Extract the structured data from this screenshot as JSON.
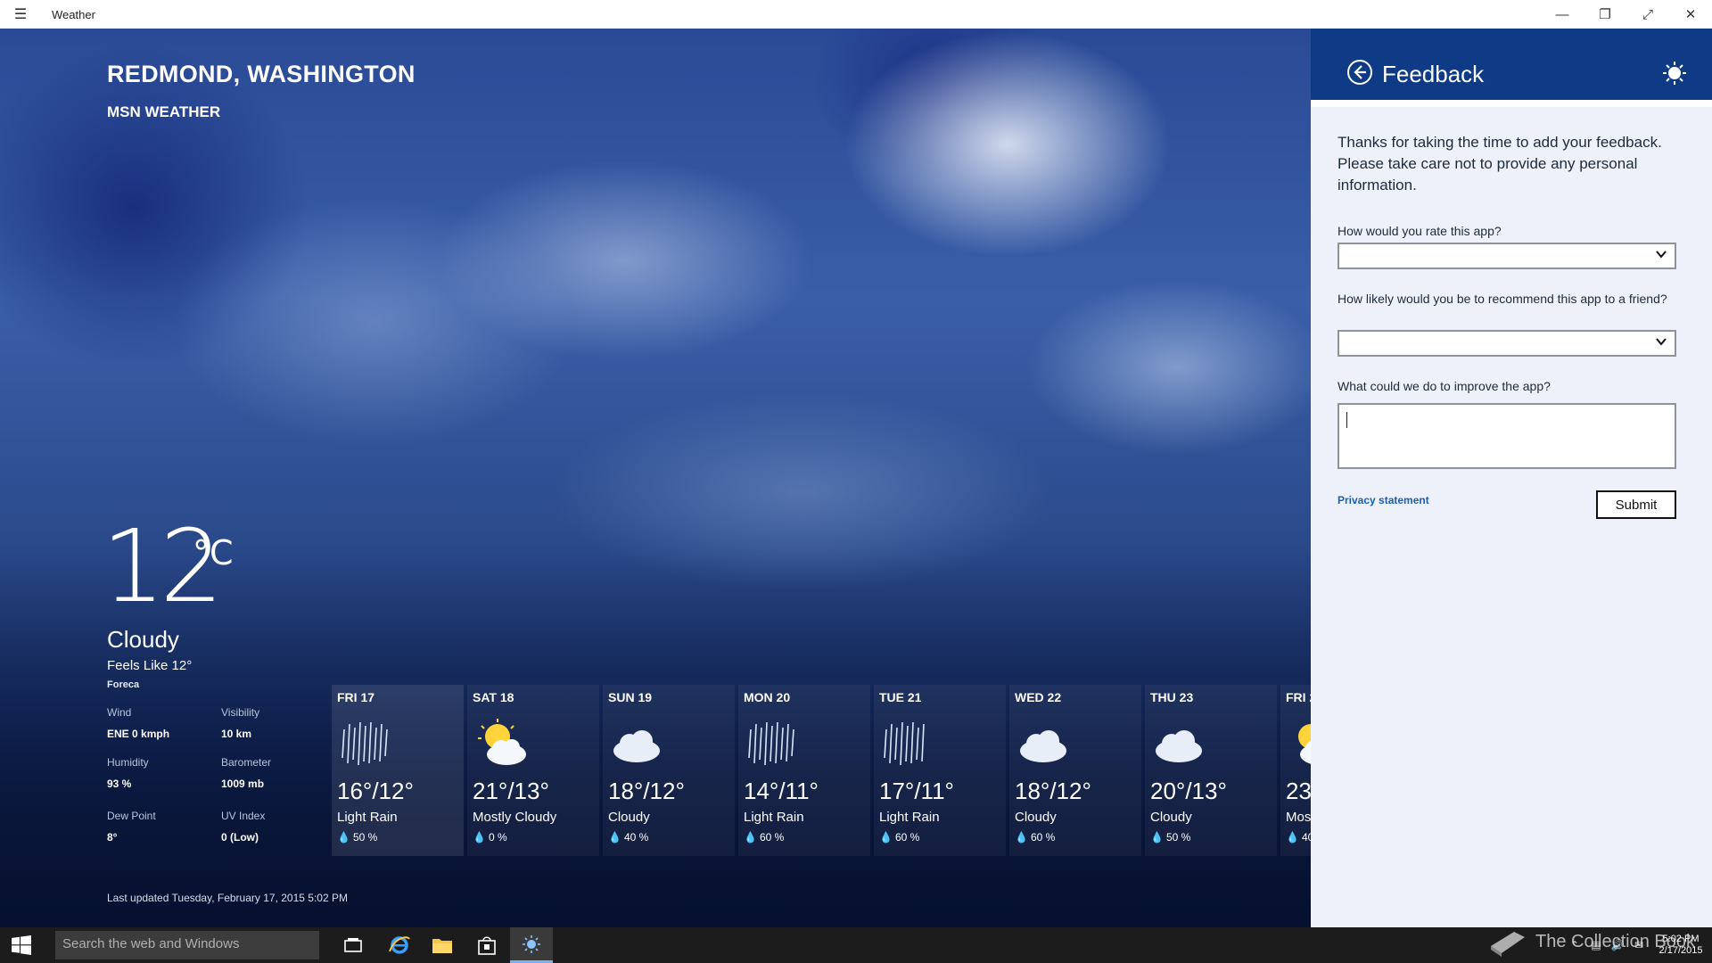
{
  "window": {
    "title": "Weather"
  },
  "location": {
    "name": "REDMOND, WASHINGTON",
    "source": "MSN WEATHER"
  },
  "current": {
    "temperature": "12",
    "unit": "°C",
    "condition": "Cloudy",
    "feels_like": "Feels Like 12°",
    "provider": "Foreca",
    "details": [
      {
        "label": "Wind",
        "value": "ENE 0 kmph"
      },
      {
        "label": "Visibility",
        "value": "10 km"
      },
      {
        "label": "Humidity",
        "value": "93 %"
      },
      {
        "label": "Barometer",
        "value": "1009 mb"
      },
      {
        "label": "Dew Point",
        "value": "8°"
      },
      {
        "label": "UV Index",
        "value": "0 (Low)"
      }
    ],
    "last_updated": "Last updated Tuesday, February 17, 2015 5:02 PM"
  },
  "forecast": [
    {
      "day": "FRI 17",
      "hilo": "16°/12°",
      "desc": "Light Rain",
      "precip": "50 %",
      "icon": "rain-icon"
    },
    {
      "day": "SAT 18",
      "hilo": "21°/13°",
      "desc": "Mostly Cloudy",
      "precip": "0 %",
      "icon": "partly-sunny-icon"
    },
    {
      "day": "SUN 19",
      "hilo": "18°/12°",
      "desc": "Cloudy",
      "precip": "40 %",
      "icon": "cloud-icon"
    },
    {
      "day": "MON 20",
      "hilo": "14°/11°",
      "desc": "Light Rain",
      "precip": "60 %",
      "icon": "rain-icon"
    },
    {
      "day": "TUE 21",
      "hilo": "17°/11°",
      "desc": "Light Rain",
      "precip": "60 %",
      "icon": "rain-icon"
    },
    {
      "day": "WED 22",
      "hilo": "18°/12°",
      "desc": "Cloudy",
      "precip": "60 %",
      "icon": "cloud-icon"
    },
    {
      "day": "THU 23",
      "hilo": "20°/13°",
      "desc": "Cloudy",
      "precip": "50 %",
      "icon": "cloud-icon"
    },
    {
      "day": "FRI 2",
      "hilo": "23",
      "desc": "Mos",
      "precip": "40",
      "icon": "partly-sunny-icon"
    }
  ],
  "feedback": {
    "title": "Feedback",
    "intro": "Thanks for taking the time to add your feedback. Please take care not to provide any personal information.",
    "q_rate": "How would you rate this app?",
    "q_recommend": "How likely would you be to recommend this app to a friend?",
    "q_improve": "What could we do to improve the app?",
    "rate_value": "",
    "recommend_value": "",
    "improve_value": "",
    "privacy": "Privacy statement",
    "submit": "Submit"
  },
  "taskbar": {
    "search_placeholder": "Search the web and Windows",
    "time": "5:02 PM",
    "date": "2/17/2015",
    "watermark": "The Collection Book"
  },
  "colors": {
    "panel_header": "#0f3a86",
    "panel_bg": "#eef1fa",
    "link": "#1a5fb4"
  }
}
